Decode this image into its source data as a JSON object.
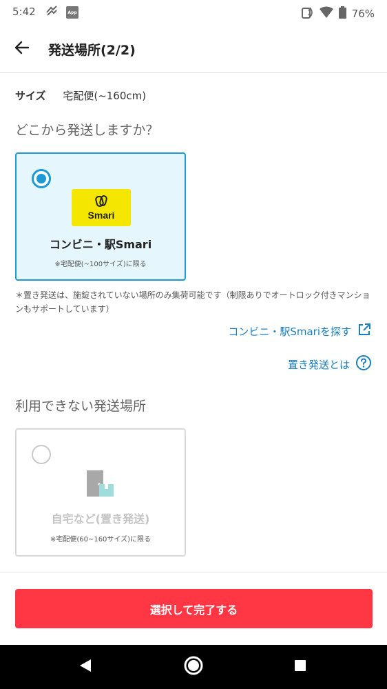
{
  "status_bar": {
    "time": "5:42",
    "battery": "76%",
    "icons": [
      "vibration-icon",
      "app-notification-icon",
      "nfc-icon",
      "wifi-icon",
      "battery-icon"
    ],
    "app_badge": "App"
  },
  "header": {
    "title": "発送場所(2/2)",
    "back_icon": "arrow-left-icon"
  },
  "size": {
    "label": "サイズ",
    "value": "宅配便(~160cm)"
  },
  "question": "どこから発送しますか？",
  "available_option": {
    "selected": true,
    "logo_text": "Smari",
    "title": "コンビニ・駅Smari",
    "note": "※宅配便(~100サイズ)に限る"
  },
  "disclaimer": "＊置き発送は、施錠されていない場所のみ集荷可能です（制限ありでオートロック付きマンションもサポートしています）",
  "links": {
    "find_smari": "コンビニ・駅Smariを探す",
    "what_is_oki": "置き発送とは"
  },
  "unavailable_section": {
    "title": "利用できない発送場所",
    "option": {
      "selected": false,
      "title": "自宅など(置き発送)",
      "note": "※宅配便(60~160サイズ)に限る"
    }
  },
  "submit_label": "選択して完了する",
  "colors": {
    "accent_blue": "#1b9ad6",
    "link_blue": "#1a7fc1",
    "primary_red": "#ff3644",
    "smari_yellow": "#f5e600"
  }
}
